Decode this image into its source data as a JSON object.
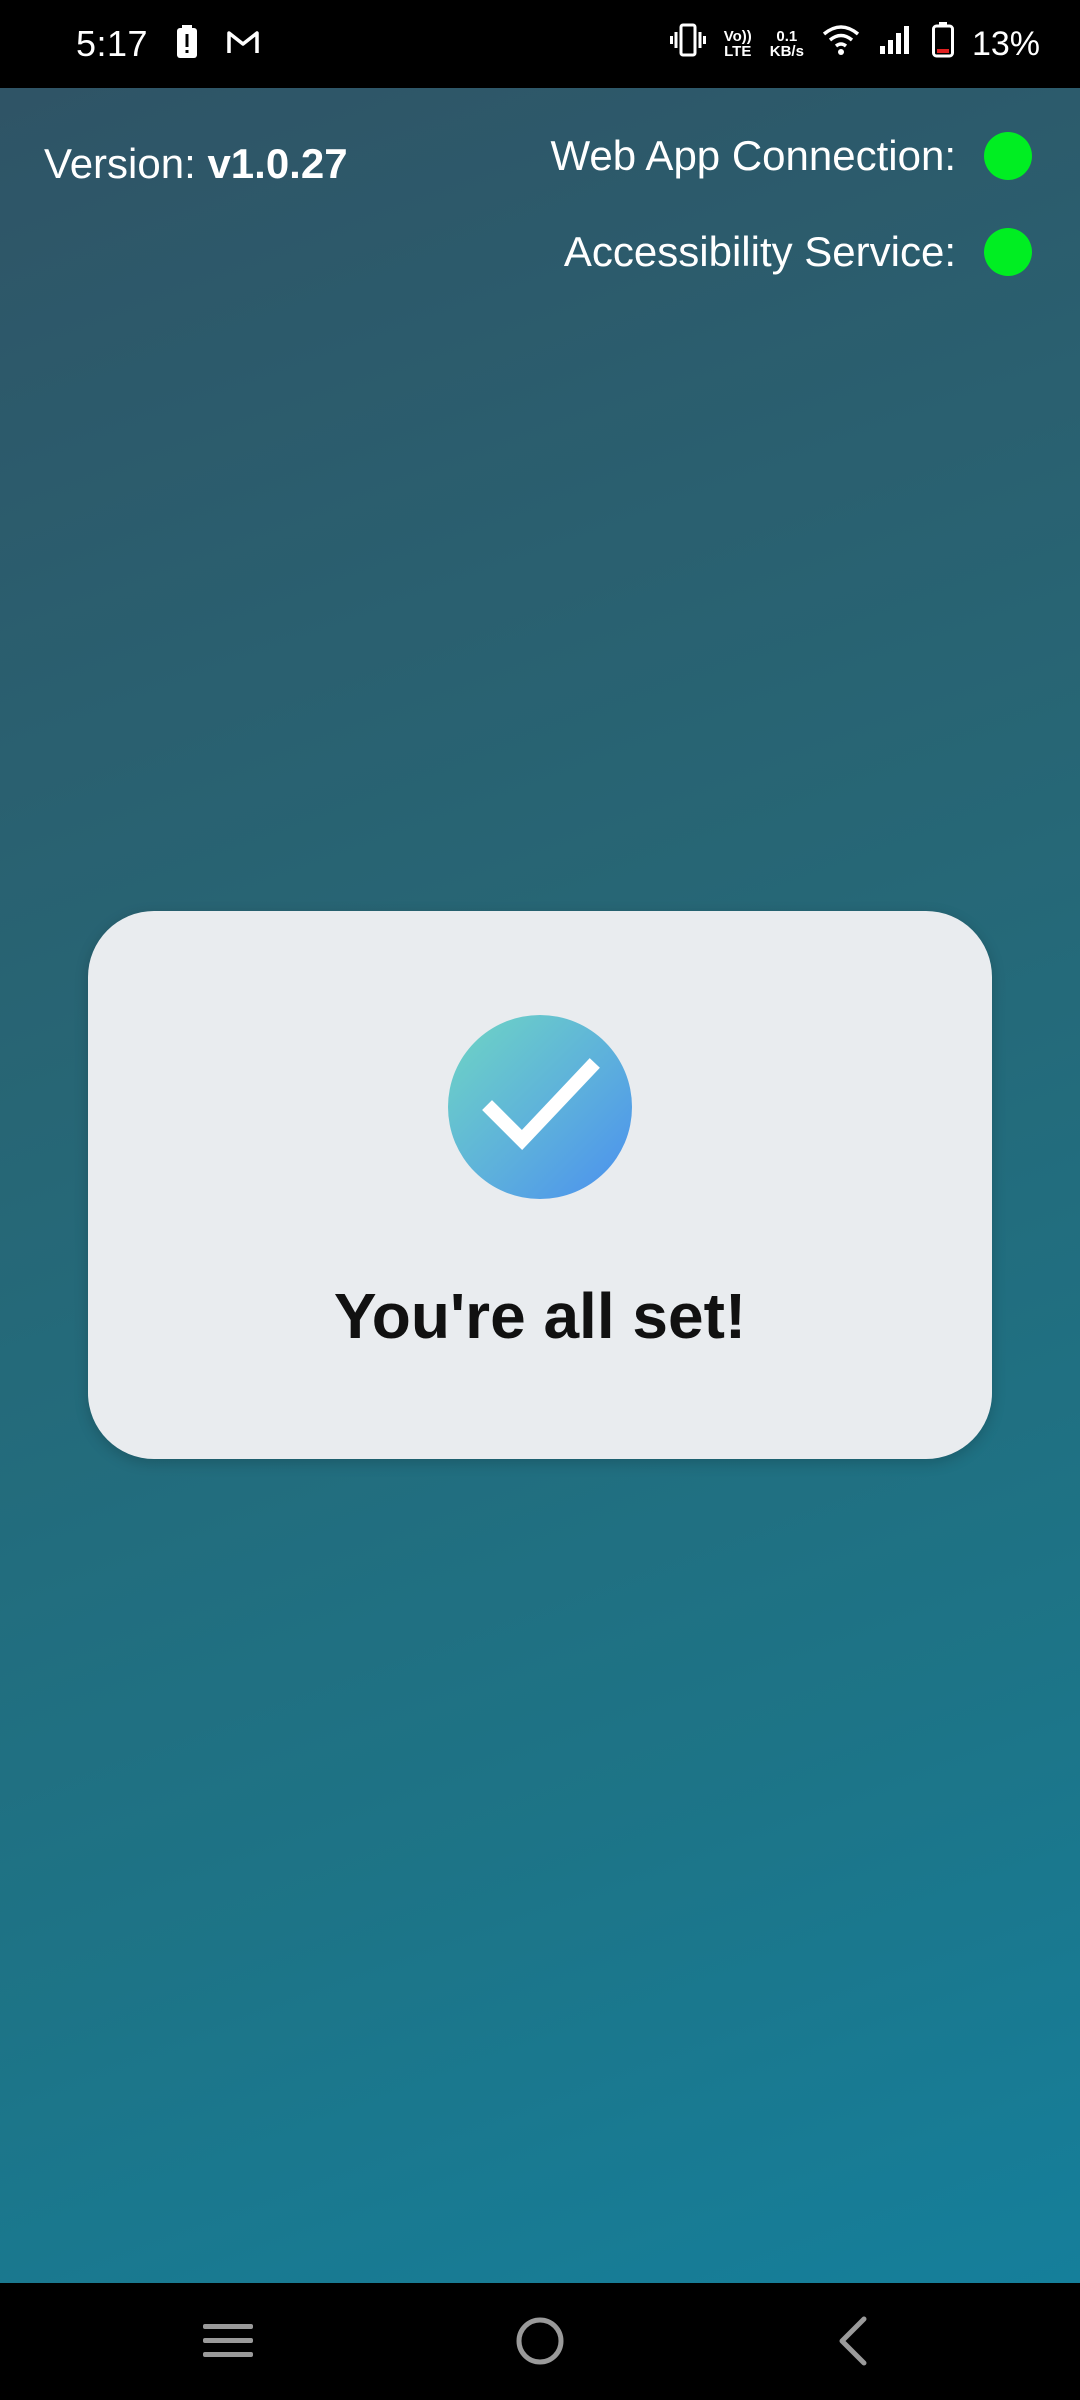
{
  "status_bar": {
    "time": "5:17",
    "net_top": "0.1",
    "net_bottom": "KB/s",
    "volte_top": "Vo))",
    "volte_bottom": "LTE",
    "battery": "13%",
    "icons": [
      "battery-alert-icon",
      "gmail-icon",
      "vibrate-icon",
      "volte-icon",
      "wifi-icon",
      "signal-icon",
      "battery-icon"
    ]
  },
  "header": {
    "version_label": "Version: ",
    "version_value": "v1.0.27",
    "web_app_label": "Web App Connection:",
    "accessibility_label": "Accessibility Service:",
    "indicator_color": "#00ee22"
  },
  "card": {
    "title": "You're all set!",
    "icon": "check-circle-icon"
  },
  "nav": {
    "icons": [
      "menu-icon",
      "home-icon",
      "back-icon"
    ]
  }
}
